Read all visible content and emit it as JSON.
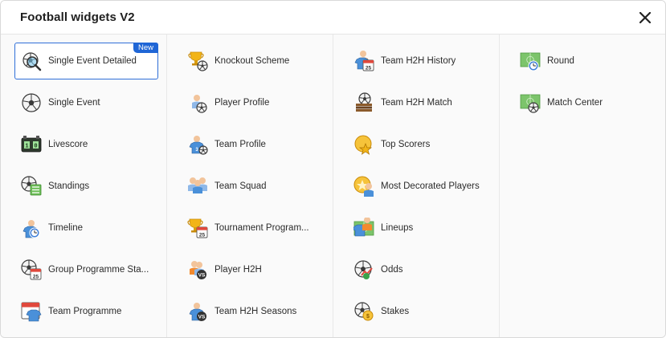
{
  "dialog": {
    "title": "Football widgets V2",
    "close_label": "×"
  },
  "colors": {
    "accent": "#1f66d6",
    "selected_border": "#2f6fd8"
  },
  "columns": [
    {
      "items": [
        {
          "label": "Single Event Detailed",
          "icon": "ball-magnifier-icon",
          "selected": true,
          "badge": "New"
        },
        {
          "label": "Single Event",
          "icon": "soccer-ball-icon"
        },
        {
          "label": "Livescore",
          "icon": "scoreboard-icon"
        },
        {
          "label": "Standings",
          "icon": "ball-table-icon"
        },
        {
          "label": "Timeline",
          "icon": "player-clock-icon"
        },
        {
          "label": "Group Programme Sta...",
          "icon": "ball-calendar-icon"
        },
        {
          "label": "Team Programme",
          "icon": "calendar-shirt-icon"
        }
      ]
    },
    {
      "items": [
        {
          "label": "Knockout Scheme",
          "icon": "trophy-ball-icon"
        },
        {
          "label": "Player Profile",
          "icon": "player-ball-icon"
        },
        {
          "label": "Team Profile",
          "icon": "team-shirt-icon"
        },
        {
          "label": "Team Squad",
          "icon": "players-group-icon"
        },
        {
          "label": "Tournament Program...",
          "icon": "trophy-calendar-icon"
        },
        {
          "label": "Player H2H",
          "icon": "player-vs-icon"
        },
        {
          "label": "Team H2H Seasons",
          "icon": "team-vs-icon"
        }
      ]
    },
    {
      "items": [
        {
          "label": "Team H2H History",
          "icon": "team-calendar-icon"
        },
        {
          "label": "Team H2H Match",
          "icon": "ball-books-icon"
        },
        {
          "label": "Top Scorers",
          "icon": "gold-ball-star-icon"
        },
        {
          "label": "Most Decorated Players",
          "icon": "gold-medal-player-icon"
        },
        {
          "label": "Lineups",
          "icon": "pitch-shirt-icon"
        },
        {
          "label": "Odds",
          "icon": "ball-chart-icon"
        },
        {
          "label": "Stakes",
          "icon": "ball-coin-icon"
        }
      ]
    },
    {
      "items": [
        {
          "label": "Round",
          "icon": "pitch-clock-icon"
        },
        {
          "label": "Match Center",
          "icon": "pitch-ball-icon"
        }
      ]
    }
  ]
}
